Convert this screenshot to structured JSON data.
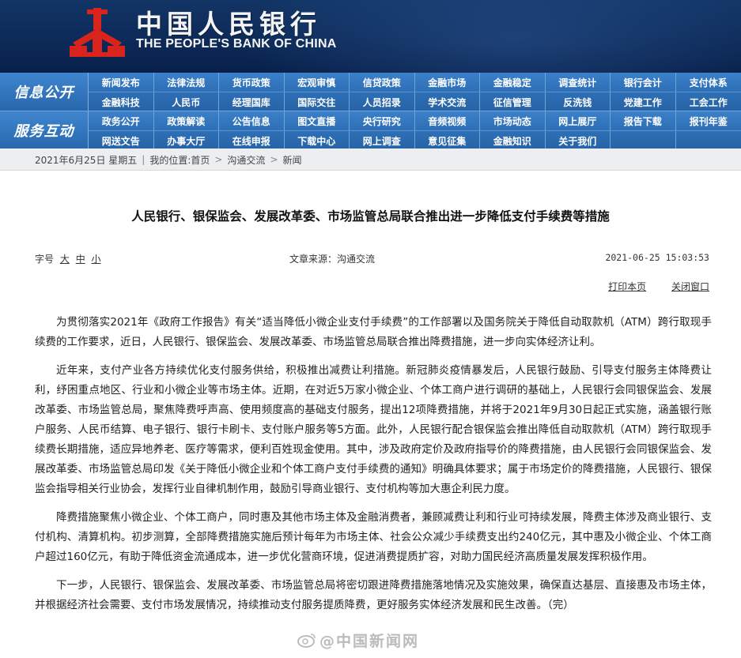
{
  "header": {
    "name_cn": "中国人民银行",
    "name_en": "THE PEOPLE'S BANK OF CHINA",
    "emblem_color": "#d9231d"
  },
  "nav": {
    "section1_label": "信息公开",
    "section2_label": "服务互动",
    "rows": [
      [
        "新闻发布",
        "法律法规",
        "货币政策",
        "宏观审慎",
        "信贷政策",
        "金融市场",
        "金融稳定",
        "调查统计",
        "银行会计",
        "支付体系"
      ],
      [
        "金融科技",
        "人民币",
        "经理国库",
        "国际交往",
        "人员招录",
        "学术交流",
        "征信管理",
        "反洗钱",
        "党建工作",
        "工会工作"
      ],
      [
        "政务公开",
        "政策解读",
        "公告信息",
        "图文直播",
        "央行研究",
        "音频视频",
        "市场动态",
        "网上展厅",
        "报告下载",
        "报刊年鉴"
      ],
      [
        "网送文告",
        "办事大厅",
        "在线申报",
        "下载中心",
        "网上调查",
        "意见征集",
        "金融知识",
        "关于我们",
        "",
        ""
      ]
    ]
  },
  "breadcrumb": {
    "date": "2021年6月25日 星期五",
    "location_label": "我的位置:首页",
    "level2": "沟通交流",
    "level3": "新闻"
  },
  "article": {
    "title": "人民银行、银保监会、发展改革委、市场监管总局联合推出进一步降低支付手续费等措施",
    "fontsize_label": "字号",
    "fontsize_large": "大",
    "fontsize_medium": "中",
    "fontsize_small": "小",
    "source": "文章来源：沟通交流",
    "datetime": "2021-06-25 15:03:53",
    "print_label": "打印本页",
    "close_label": "关闭窗口",
    "paragraphs": [
      "为贯彻落实2021年《政府工作报告》有关“适当降低小微企业支付手续费”的工作部署以及国务院关于降低自动取款机（ATM）跨行取现手续费的工作要求，近日，人民银行、银保监会、发展改革委、市场监管总局联合推出降费措施，进一步向实体经济让利。",
      "近年来，支付产业各方持续优化支付服务供给，积极推出减费让利措施。新冠肺炎疫情暴发后，人民银行鼓励、引导支付服务主体降费让利，纾困重点地区、行业和小微企业等市场主体。近期，在对近5万家小微企业、个体工商户进行调研的基础上，人民银行会同银保监会、发展改革委、市场监管总局，聚焦降费呼声高、使用频度高的基础支付服务，提出12项降费措施，并将于2021年9月30日起正式实施，涵盖银行账户服务、人民币结算、电子银行、银行卡刷卡、支付账户服务等5方面。此外，人民银行配合银保监会推出降低自动取款机（ATM）跨行取现手续费长期措施，适应异地养老、医疗等需求，便利百姓现金使用。其中，涉及政府定价及政府指导价的降费措施，由人民银行会同银保监会、发展改革委、市场监管总局印发《关于降低小微企业和个体工商户支付手续费的通知》明确具体要求；属于市场定价的降费措施，人民银行、银保监会指导相关行业协会，发挥行业自律机制作用，鼓励引导商业银行、支付机构等加大惠企利民力度。",
      "降费措施聚焦小微企业、个体工商户，同时惠及其他市场主体及金融消费者，兼顾减费让利和行业可持续发展，降费主体涉及商业银行、支付机构、清算机构。初步测算，全部降费措施实施后预计每年为市场主体、社会公众减少手续费支出约240亿元，其中惠及小微企业、个体工商户超过160亿元，有助于降低资金流通成本，进一步优化营商环境，促进消费提质扩容，对助力国民经济高质量发展发挥积极作用。",
      "下一步，人民银行、银保监会、发展改革委、市场监管总局将密切跟进降费措施落地情况及实施效果，确保直达基层、直接惠及市场主体，并根据经济社会需要、支付市场发展情况，持续推动支付服务提质降费，更好服务实体经济发展和民生改善。（完）"
    ]
  },
  "watermark": {
    "text": "@中国新闻网"
  }
}
